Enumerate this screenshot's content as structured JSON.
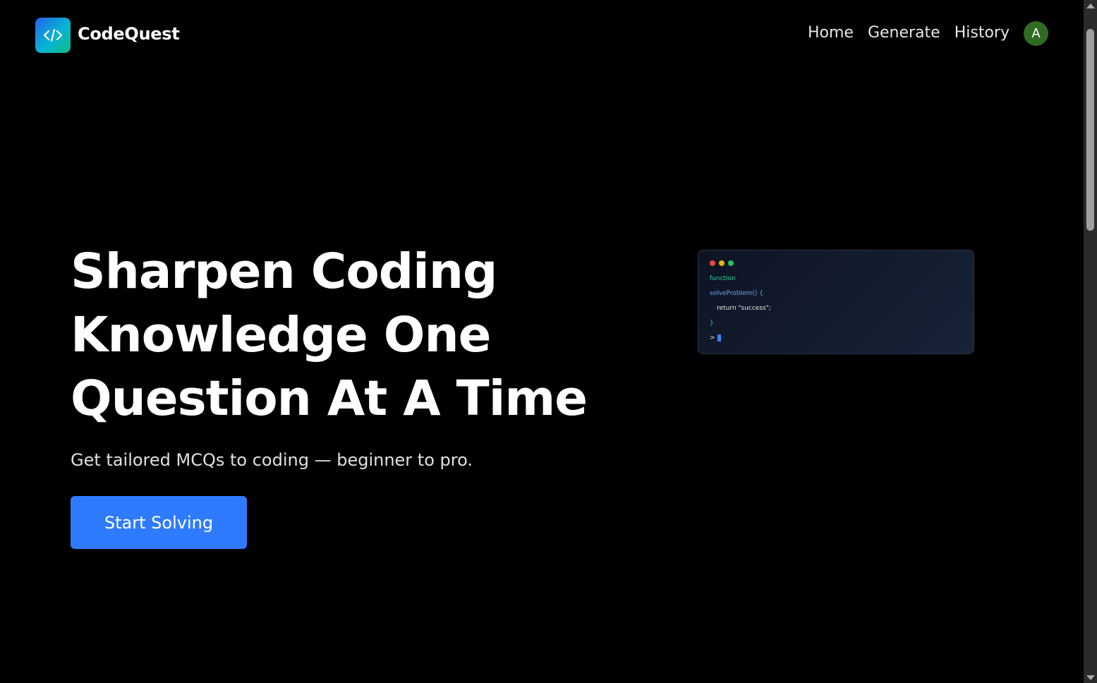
{
  "brand": {
    "name": "CodeQuest",
    "logo_icon": "code-brackets-icon",
    "logo_colors": [
      "#2563eb",
      "#06b6d4",
      "#10b981"
    ]
  },
  "nav": {
    "items": [
      {
        "label": "Home"
      },
      {
        "label": "Generate"
      },
      {
        "label": "History"
      }
    ],
    "avatar_initial": "A",
    "avatar_color": "#2f6b23"
  },
  "hero": {
    "title_lines": [
      "Sharpen Coding",
      "Knowledge One",
      "Question At A Time"
    ],
    "subtitle": "Get tailored MCQs to coding — beginner to pro.",
    "cta_label": "Start Solving",
    "cta_color": "#2f7bff"
  },
  "code_card": {
    "window_dots": [
      "#ef4444",
      "#eab308",
      "#22c55e"
    ],
    "lines": [
      {
        "text": "function",
        "color": "#34d399"
      },
      {
        "text": "solveProblem() {",
        "color": "#60a5fa"
      },
      {
        "text": "return \"success\";",
        "color": "#e5e7eb"
      },
      {
        "text": "}",
        "color": "#60a5fa"
      },
      {
        "text": ">",
        "color": "#e5e7eb"
      }
    ]
  }
}
